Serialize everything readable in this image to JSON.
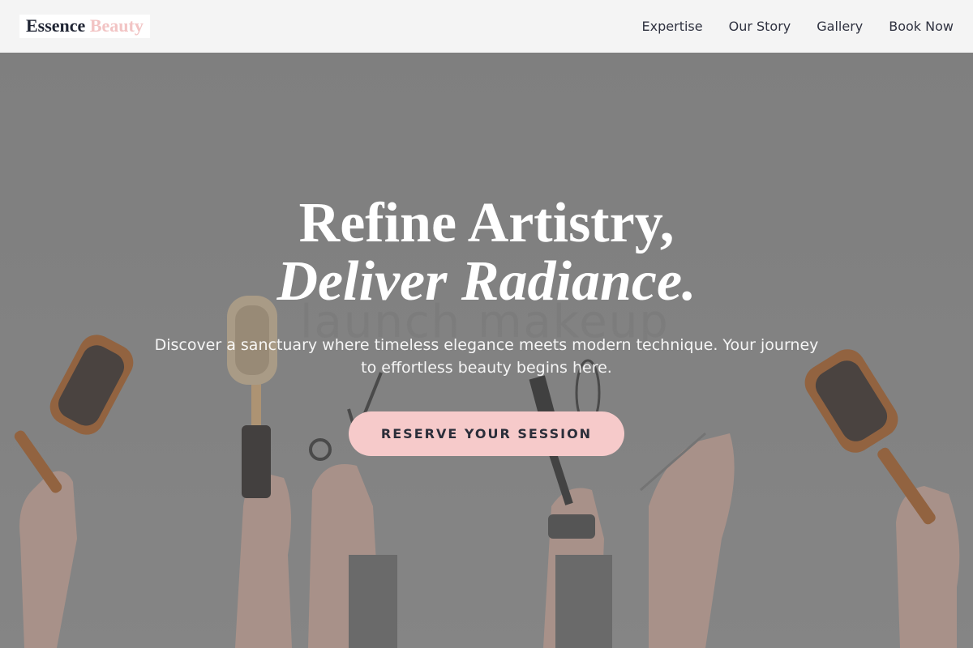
{
  "brand": {
    "name": "Essence",
    "accent": "Beauty"
  },
  "nav": {
    "items": [
      {
        "label": "Expertise"
      },
      {
        "label": "Our Story"
      },
      {
        "label": "Gallery"
      },
      {
        "label": "Book Now"
      }
    ]
  },
  "hero": {
    "headline_line1": "Refine Artistry,",
    "headline_line2": "Deliver Radiance.",
    "subtext": "Discover a sanctuary where timeless elegance meets modern technique. Your journey to effortless beauty begins here.",
    "cta_label": "RESERVE YOUR SESSION",
    "background_text": "launch makeup"
  },
  "colors": {
    "accent_pink": "#f6caca",
    "logo_accent": "#f2c4c4",
    "header_bg": "#f4f4f4",
    "text_dark": "#2b2e3a"
  }
}
